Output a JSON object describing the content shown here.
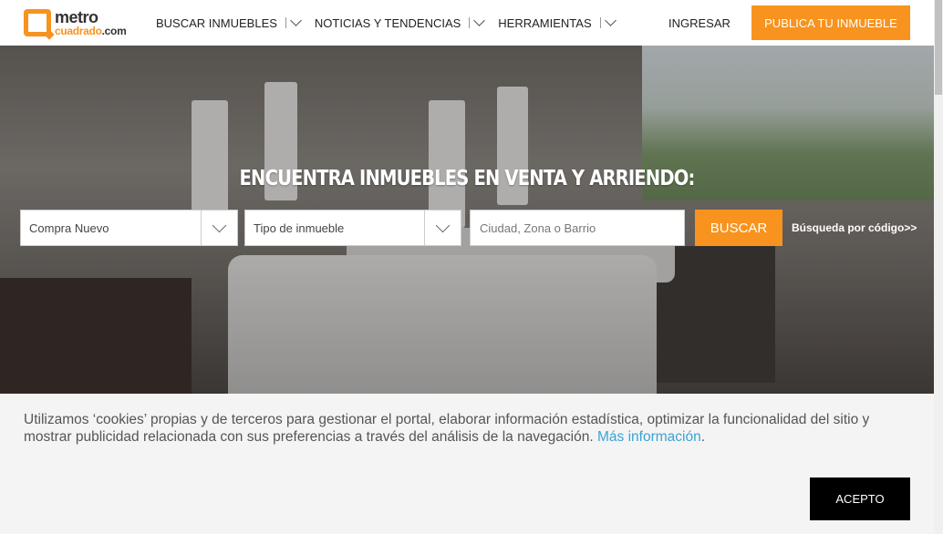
{
  "header": {
    "logo_top": "metro",
    "logo_bottom": "cuadrado",
    "logo_suffix": ".com",
    "nav": [
      {
        "label": "BUSCAR INMUEBLES"
      },
      {
        "label": "NOTICIAS Y TENDENCIAS"
      },
      {
        "label": "HERRAMIENTAS"
      }
    ],
    "login_label": "INGRESAR",
    "publish_label": "PUBLICA TU INMUEBLE"
  },
  "hero": {
    "title": "ENCUENTRA INMUEBLES EN VENTA Y ARRIENDO:",
    "operation_select": "Compra Nuevo",
    "type_select": "Tipo de inmueble",
    "location_placeholder": "Ciudad, Zona o Barrio",
    "search_label": "BUSCAR",
    "code_search_label": "Búsqueda por código>>"
  },
  "cookie": {
    "text": "Utilizamos ‘cookies’ propias y de terceros para gestionar el portal, elaborar información estadística, optimizar la funcionalidad del sitio y mostrar publicidad relacionada con sus preferencias a través del análisis de la navegación.",
    "link_label": "Más información",
    "trailing": ".",
    "accept_label": "ACEPTO"
  },
  "colors": {
    "accent": "#f7931e",
    "link": "#3aa3d4",
    "accept_bg": "#000000"
  }
}
